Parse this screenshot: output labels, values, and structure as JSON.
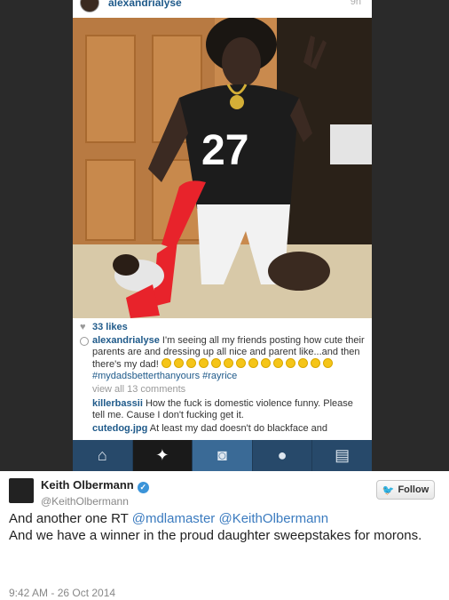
{
  "instagram": {
    "username": "alexandrialyse",
    "time": "9h",
    "likes": "33 likes",
    "caption": {
      "user": "alexandrialyse",
      "text": "I'm seeing all my friends posting how cute their parents are and dressing up all nice and parent like...and then there's my dad!",
      "hashtags": "#mydadsbetterthanyours #rayrice"
    },
    "view_all": "view all 13 comments",
    "comments": [
      {
        "user": "killerbassii",
        "text": "How the fuck is domestic violence funny. Please tell me. Cause I don't fucking get it."
      },
      {
        "user": "cutedog.jpg",
        "text": "At least my dad doesn't do blackface and"
      }
    ],
    "jersey_number": "27",
    "nav": [
      {
        "icon": "home-icon",
        "glyph": "⌂"
      },
      {
        "icon": "explore-icon",
        "glyph": "✦"
      },
      {
        "icon": "camera-icon",
        "glyph": "◙"
      },
      {
        "icon": "activity-icon",
        "glyph": "●"
      },
      {
        "icon": "profile-icon",
        "glyph": "▤"
      }
    ]
  },
  "tweet": {
    "name": "Keith Olbermann",
    "handle": "@KeithOlbermann",
    "follow_label": "Follow",
    "text_prefix": "And another one RT ",
    "mention1": "@mdlamaster",
    "mention2": "@KeithOlbermann",
    "text_rest": "And we have a winner in the proud daughter sweepstakes for morons.",
    "timestamp": "9:42 AM - 26 Oct 2014"
  },
  "colors": {
    "link": "#1f5a8a",
    "twitter_blue": "#3b94d9",
    "insta_nav": "#27496a"
  }
}
